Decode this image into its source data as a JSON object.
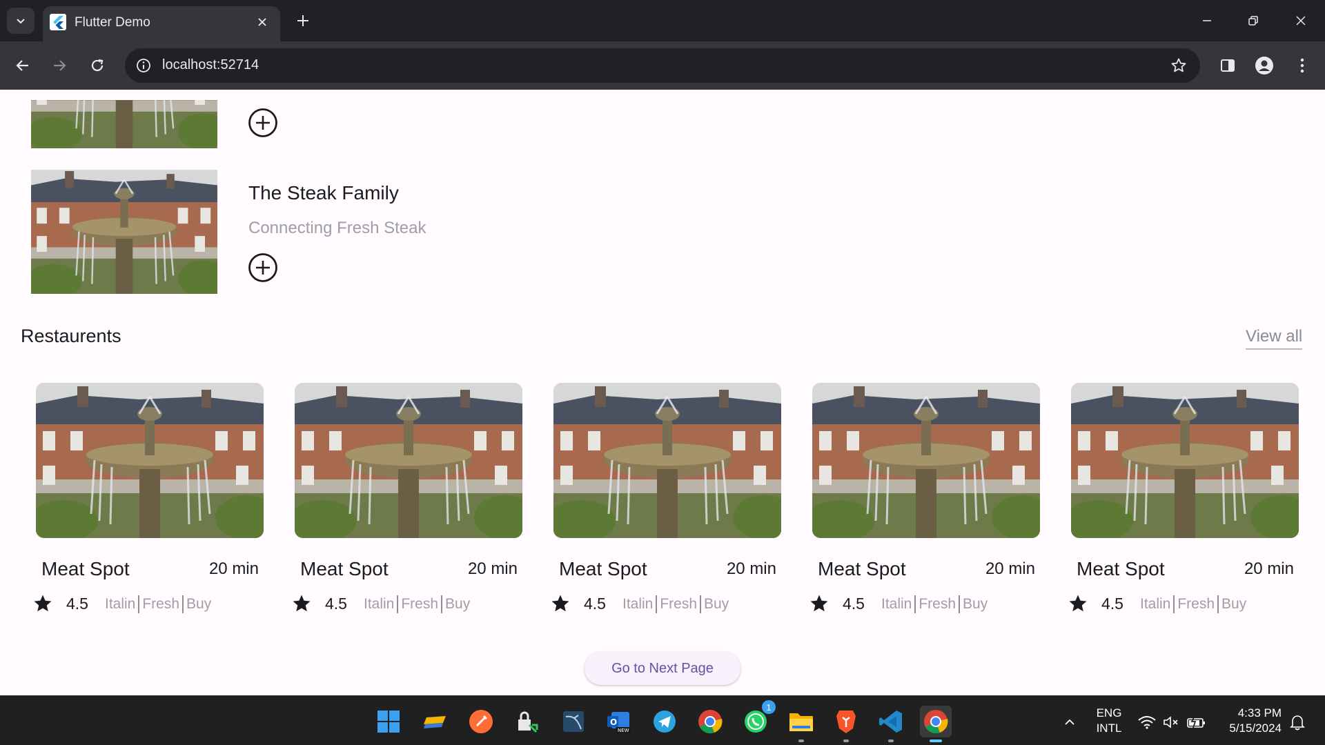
{
  "browser": {
    "tab_title": "Flutter Demo",
    "url": "localhost:52714"
  },
  "page": {
    "featured": [
      {
        "title": "",
        "subtitle": ""
      },
      {
        "title": "The Steak Family",
        "subtitle": "Connecting Fresh Steak"
      }
    ],
    "section_title": "Restaurents",
    "view_all": "View all",
    "cards": [
      {
        "name": "Meat Spot",
        "time": "20 min",
        "rating": "4.5",
        "tags": [
          "Italin",
          "Fresh",
          "Buy"
        ]
      },
      {
        "name": "Meat Spot",
        "time": "20 min",
        "rating": "4.5",
        "tags": [
          "Italin",
          "Fresh",
          "Buy"
        ]
      },
      {
        "name": "Meat Spot",
        "time": "20 min",
        "rating": "4.5",
        "tags": [
          "Italin",
          "Fresh",
          "Buy"
        ]
      },
      {
        "name": "Meat Spot",
        "time": "20 min",
        "rating": "4.5",
        "tags": [
          "Italin",
          "Fresh",
          "Buy"
        ]
      },
      {
        "name": "Meat Spot",
        "time": "20 min",
        "rating": "4.5",
        "tags": [
          "Italin",
          "Fresh",
          "Buy"
        ]
      }
    ],
    "next_button": "Go to Next Page"
  },
  "taskbar": {
    "apps": [
      "windows-start",
      "sticky-notes",
      "postman",
      "lock-app",
      "mysql-workbench",
      "outlook-new",
      "telegram",
      "chrome",
      "whatsapp",
      "file-explorer",
      "brave",
      "vscode",
      "chrome-active"
    ],
    "whatsapp_badge": "1",
    "lang_line1": "ENG",
    "lang_line2": "INTL",
    "time": "4:33 PM",
    "date": "5/15/2024"
  },
  "colors": {
    "accent": "#6750a4",
    "page_bg": "#fffbfe",
    "tab_bg": "#35363a",
    "frame_bg": "#202124"
  }
}
